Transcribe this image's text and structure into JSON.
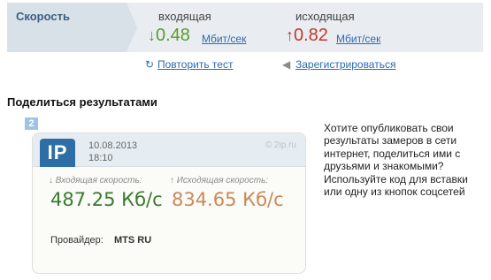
{
  "speed_strip": {
    "label": "Скорость",
    "incoming_caption": "входящая",
    "outgoing_caption": "исходящая",
    "incoming_arrow": "↓",
    "outgoing_arrow": "↑",
    "incoming_value": "0.48",
    "outgoing_value": "0.82",
    "incoming_unit": "Мбит/сек",
    "outgoing_unit": "Мбит/сек"
  },
  "links": {
    "repeat_label": "Повторить тест",
    "register_label": "Зарегистрироваться"
  },
  "share": {
    "title": "Поделиться результатами",
    "badge": "2",
    "description": "Хотите опубликовать свои результаты замеров в сети интернет, поделиться ими с друзьями и знакомыми? Используйте код для вставки или одну из кнопок соцсетей"
  },
  "card": {
    "logo": "IP",
    "date": "10.08.2013",
    "time": "18:10",
    "site": "© 2ip.ru",
    "incoming_caption": "Входящая скорость:",
    "outgoing_caption": "Исходящая скорость:",
    "incoming_arrow": "↓",
    "outgoing_arrow": "↑",
    "incoming_speed": "487.25 Кб/с",
    "outgoing_speed": "834.65 Кб/с",
    "provider_label": "Провайдер:",
    "provider_value": "MTS RU"
  },
  "icons": {
    "repeat": "refresh-icon",
    "register": "arrow-left-icon"
  }
}
